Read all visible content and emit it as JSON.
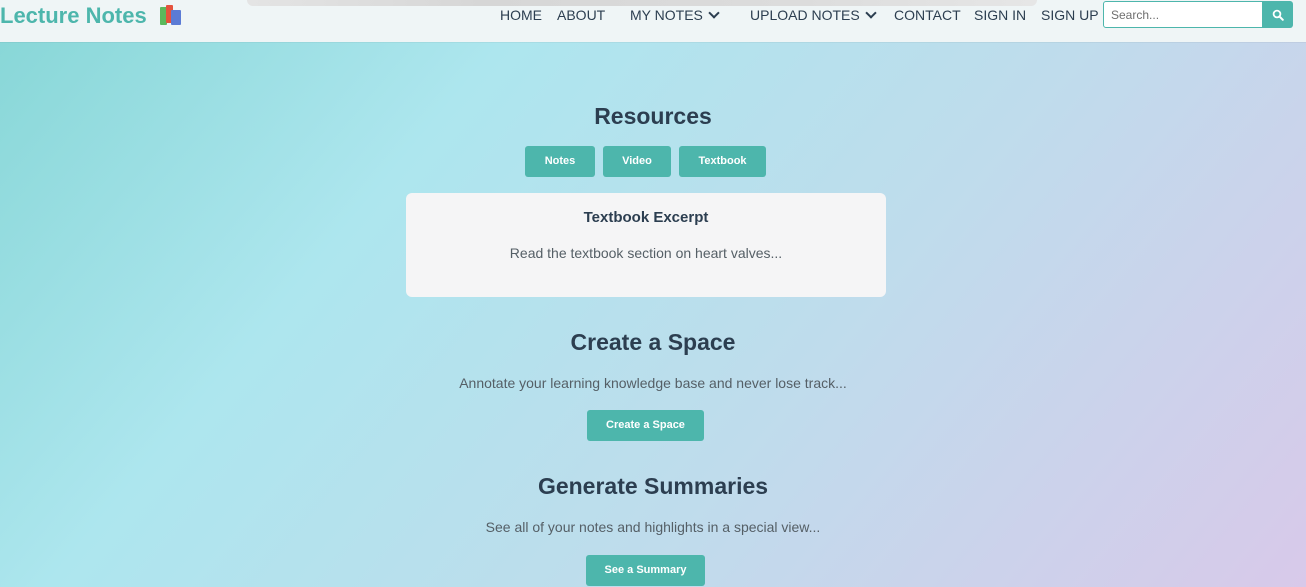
{
  "brand": {
    "name": "Lecture Notes",
    "icon": "books-icon"
  },
  "nav": {
    "home": "HOME",
    "about": "ABOUT",
    "my_notes": "MY NOTES",
    "upload_notes": "UPLOAD NOTES",
    "contact": "CONTACT",
    "sign_in": "SIGN IN",
    "sign_up": "SIGN UP"
  },
  "search": {
    "placeholder": "Search...",
    "value": "",
    "icon": "search-icon"
  },
  "resources": {
    "title": "Resources",
    "tabs": [
      "Notes",
      "Video",
      "Textbook"
    ],
    "card": {
      "title": "Textbook Excerpt",
      "text": "Read the textbook section on heart valves..."
    }
  },
  "create_space": {
    "title": "Create a Space",
    "description": "Annotate your learning knowledge base and never lose track...",
    "button": "Create a Space"
  },
  "summaries": {
    "title": "Generate Summaries",
    "description": "See all of your notes and highlights in a special view...",
    "button": "See a Summary"
  },
  "colors": {
    "accent": "#4db6ac",
    "text": "#2c3e50",
    "navbar_bg": "#eff5f6",
    "card_bg": "#f5f5f6"
  }
}
